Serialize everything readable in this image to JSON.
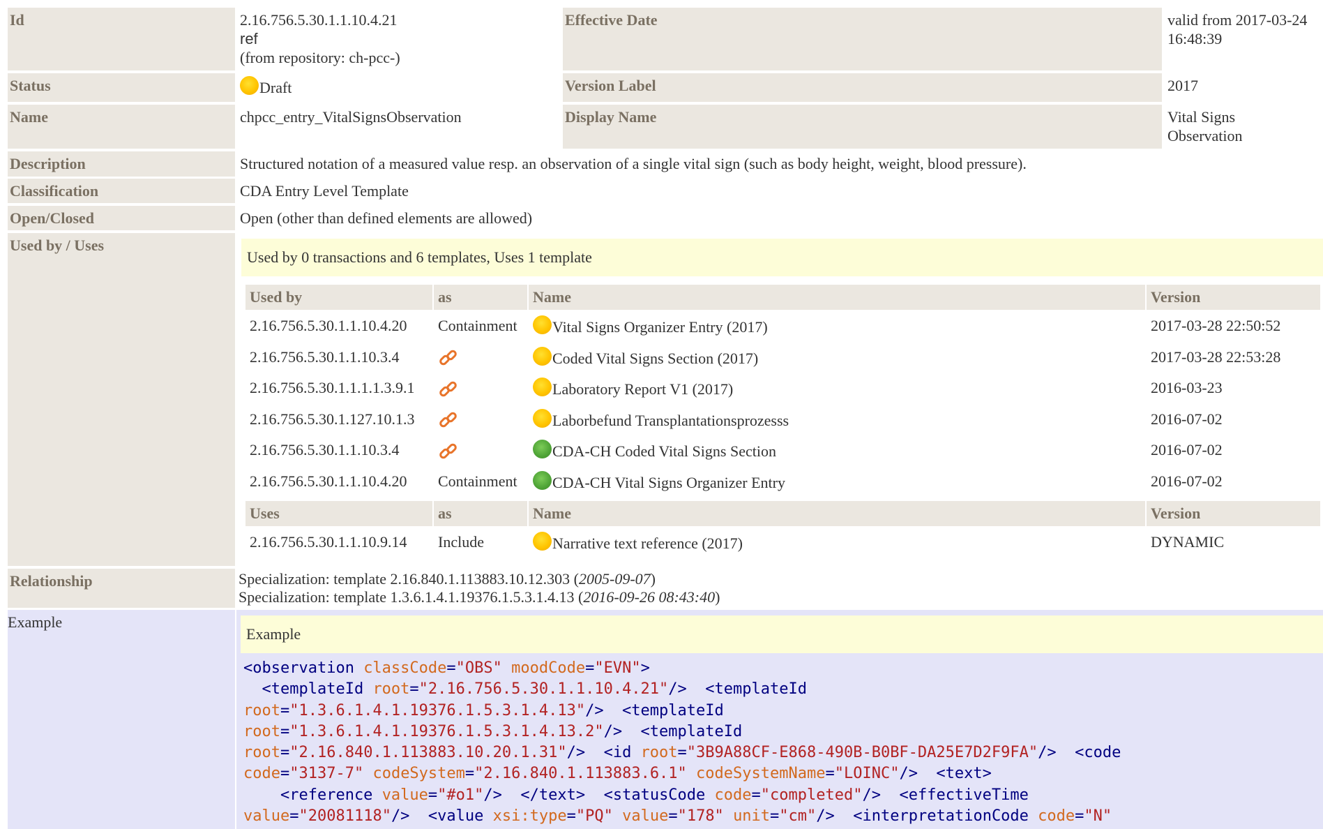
{
  "rows": {
    "id": {
      "label": "Id",
      "value": "2.16.756.5.30.1.1.10.4.21",
      "ref": "ref",
      "repository": "(from repository: ch-pcc-)"
    },
    "effective_date": {
      "label": "Effective Date",
      "value_line1": "valid from 2017-03-24",
      "value_line2": "16:48:39"
    },
    "status": {
      "label": "Status",
      "value": "Draft"
    },
    "version_label": {
      "label": "Version Label",
      "value": "2017"
    },
    "name": {
      "label": "Name",
      "value": "chpcc_entry_VitalSignsObservation"
    },
    "display_name": {
      "label": "Display Name",
      "value_line1": "Vital Signs",
      "value_line2": "Observation"
    },
    "description": {
      "label": "Description",
      "value": "Structured notation of a measured value resp. an observation of a single vital sign (such as body height, weight, blood pressure)."
    },
    "classification": {
      "label": "Classification",
      "value": "CDA Entry Level Template"
    },
    "open_closed": {
      "label": "Open/Closed",
      "value": "Open (other than defined elements are allowed)"
    },
    "used_by_uses": {
      "label": "Used by / Uses",
      "summary": "Used by 0 transactions and 6 templates, Uses 1 template"
    },
    "relationship": {
      "label": "Relationship",
      "lines": [
        {
          "prefix": "Specialization: template 2.16.840.1.113883.10.12.303 (",
          "date": "2005-09-07",
          "suffix": ")"
        },
        {
          "prefix": "Specialization: template 1.3.6.1.4.1.19376.1.5.3.1.4.13 (",
          "date": "2016-09-26 08:43:40",
          "suffix": ")"
        }
      ]
    },
    "example": {
      "label": "Example",
      "header": "Example"
    }
  },
  "used_by_table": {
    "headers": {
      "id": "Used by",
      "as": "as",
      "name": "Name",
      "version": "Version"
    },
    "rows": [
      {
        "id": "2.16.756.5.30.1.1.10.4.20",
        "as": "Containment",
        "status": "draft",
        "name": "Vital Signs Organizer Entry (2017)",
        "version": "2017-03-28 22:50:52"
      },
      {
        "id": "2.16.756.5.30.1.1.10.3.4",
        "as": "",
        "status": "draft",
        "name": "Coded Vital Signs Section (2017)",
        "version": "2017-03-28 22:53:28"
      },
      {
        "id": "2.16.756.5.30.1.1.1.1.3.9.1",
        "as": "",
        "status": "draft",
        "name": "Laboratory Report V1 (2017)",
        "version": "2016-03-23"
      },
      {
        "id": "2.16.756.5.30.1.127.10.1.3",
        "as": "",
        "status": "draft",
        "name": "Laborbefund Transplantationsprozesss",
        "version": "2016-07-02"
      },
      {
        "id": "2.16.756.5.30.1.1.10.3.4",
        "as": "",
        "status": "final",
        "name": "CDA-CH Coded Vital Signs Section",
        "version": "2016-07-02"
      },
      {
        "id": "2.16.756.5.30.1.1.10.4.20",
        "as": "Containment",
        "status": "final",
        "name": "CDA-CH Vital Signs Organizer Entry",
        "version": "2016-07-02"
      }
    ]
  },
  "uses_table": {
    "headers": {
      "id": "Uses",
      "as": "as",
      "name": "Name",
      "version": "Version"
    },
    "rows": [
      {
        "id": "2.16.756.5.30.1.1.10.9.14",
        "as": "Include",
        "status": "draft",
        "name": "Narrative text reference (2017)",
        "version": "DYNAMIC"
      }
    ]
  },
  "icons": {
    "draft": "draft-status-icon",
    "final": "active-status-icon",
    "link": "chain-link-icon"
  },
  "colors": {
    "label_bg": "#ebe7e0",
    "label_text": "#7a7062",
    "highlight_bg": "#fdfdd8",
    "example_bg": "#e4e4f8",
    "xml_tag": "#000080",
    "xml_attr": "#d2691e",
    "xml_value": "#b22222"
  },
  "example_code": [
    [
      {
        "t": "tag",
        "v": "<observation "
      },
      {
        "t": "attr",
        "v": "classCode"
      },
      {
        "t": "eq",
        "v": "="
      },
      {
        "t": "val",
        "v": "\"OBS\""
      },
      {
        "t": "tag",
        "v": " "
      },
      {
        "t": "attr",
        "v": "moodCode"
      },
      {
        "t": "eq",
        "v": "="
      },
      {
        "t": "val",
        "v": "\"EVN\""
      },
      {
        "t": "tag",
        "v": ">"
      }
    ],
    [
      {
        "t": "tag",
        "v": "  <templateId "
      },
      {
        "t": "attr",
        "v": "root"
      },
      {
        "t": "eq",
        "v": "="
      },
      {
        "t": "val",
        "v": "\"2.16.756.5.30.1.1.10.4.21\""
      },
      {
        "t": "tag",
        "v": "/>  <templateId"
      }
    ],
    [
      {
        "t": "attr",
        "v": "root"
      },
      {
        "t": "eq",
        "v": "="
      },
      {
        "t": "val",
        "v": "\"1.3.6.1.4.1.19376.1.5.3.1.4.13\""
      },
      {
        "t": "tag",
        "v": "/>  <templateId"
      }
    ],
    [
      {
        "t": "attr",
        "v": "root"
      },
      {
        "t": "eq",
        "v": "="
      },
      {
        "t": "val",
        "v": "\"1.3.6.1.4.1.19376.1.5.3.1.4.13.2\""
      },
      {
        "t": "tag",
        "v": "/>  <templateId"
      }
    ],
    [
      {
        "t": "attr",
        "v": "root"
      },
      {
        "t": "eq",
        "v": "="
      },
      {
        "t": "val",
        "v": "\"2.16.840.1.113883.10.20.1.31\""
      },
      {
        "t": "tag",
        "v": "/>  <id "
      },
      {
        "t": "attr",
        "v": "root"
      },
      {
        "t": "eq",
        "v": "="
      },
      {
        "t": "val",
        "v": "\"3B9A88CF-E868-490B-B0BF-DA25E7D2F9FA\""
      },
      {
        "t": "tag",
        "v": "/>  <code"
      }
    ],
    [
      {
        "t": "attr",
        "v": "code"
      },
      {
        "t": "eq",
        "v": "="
      },
      {
        "t": "val",
        "v": "\"3137-7\""
      },
      {
        "t": "tag",
        "v": " "
      },
      {
        "t": "attr",
        "v": "codeSystem"
      },
      {
        "t": "eq",
        "v": "="
      },
      {
        "t": "val",
        "v": "\"2.16.840.1.113883.6.1\""
      },
      {
        "t": "tag",
        "v": " "
      },
      {
        "t": "attr",
        "v": "codeSystemName"
      },
      {
        "t": "eq",
        "v": "="
      },
      {
        "t": "val",
        "v": "\"LOINC\""
      },
      {
        "t": "tag",
        "v": "/>  <text>"
      }
    ],
    [
      {
        "t": "tag",
        "v": "    <reference "
      },
      {
        "t": "attr",
        "v": "value"
      },
      {
        "t": "eq",
        "v": "="
      },
      {
        "t": "val",
        "v": "\"#o1\""
      },
      {
        "t": "tag",
        "v": "/>  </text>  <statusCode "
      },
      {
        "t": "attr",
        "v": "code"
      },
      {
        "t": "eq",
        "v": "="
      },
      {
        "t": "val",
        "v": "\"completed\""
      },
      {
        "t": "tag",
        "v": "/>  <effectiveTime"
      }
    ],
    [
      {
        "t": "attr",
        "v": "value"
      },
      {
        "t": "eq",
        "v": "="
      },
      {
        "t": "val",
        "v": "\"20081118\""
      },
      {
        "t": "tag",
        "v": "/>  <value "
      },
      {
        "t": "attr",
        "v": "xsi:type"
      },
      {
        "t": "eq",
        "v": "="
      },
      {
        "t": "val",
        "v": "\"PQ\""
      },
      {
        "t": "tag",
        "v": " "
      },
      {
        "t": "attr",
        "v": "value"
      },
      {
        "t": "eq",
        "v": "="
      },
      {
        "t": "val",
        "v": "\"178\""
      },
      {
        "t": "tag",
        "v": " "
      },
      {
        "t": "attr",
        "v": "unit"
      },
      {
        "t": "eq",
        "v": "="
      },
      {
        "t": "val",
        "v": "\"cm\""
      },
      {
        "t": "tag",
        "v": "/>  <interpretationCode "
      },
      {
        "t": "attr",
        "v": "code"
      },
      {
        "t": "eq",
        "v": "="
      },
      {
        "t": "val",
        "v": "\"N\""
      }
    ]
  ]
}
